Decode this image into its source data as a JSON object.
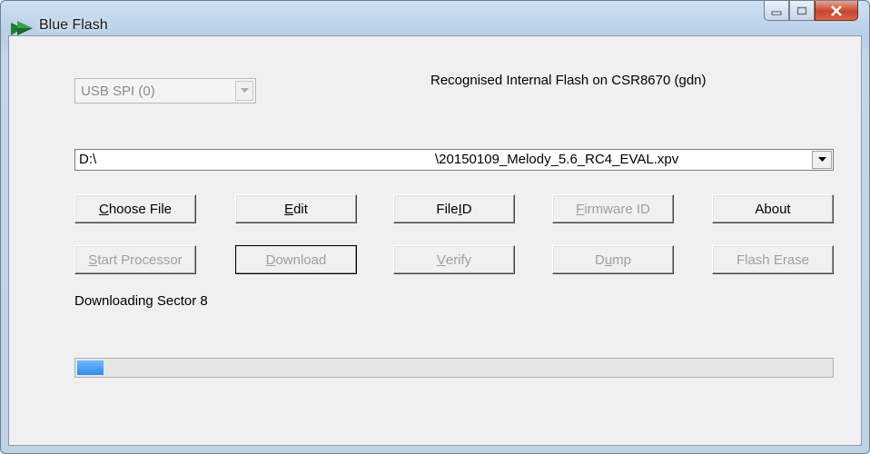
{
  "window": {
    "title": "Blue Flash",
    "icon": "blue-flash-app-icon"
  },
  "caption_buttons": {
    "minimize_icon": "minimize-icon",
    "maximize_icon": "maximize-icon",
    "close_icon": "close-icon"
  },
  "device": {
    "selected": "USB SPI (0)",
    "enabled": false
  },
  "recognised_text": "Recognised Internal Flash on CSR8670 (gdn)",
  "file_path": {
    "drive": "D:\\",
    "file": "\\20150109_Melody_5.6_RC4_EVAL.xpv"
  },
  "buttons_row1": [
    {
      "pre": "",
      "u": "C",
      "post": "hoose File",
      "enabled": true
    },
    {
      "pre": "",
      "u": "E",
      "post": "dit",
      "enabled": true
    },
    {
      "pre": "File ",
      "u": "I",
      "post": "D",
      "enabled": true
    },
    {
      "pre": "",
      "u": "F",
      "post": "irmware ID",
      "enabled": false
    },
    {
      "pre": "About",
      "u": "",
      "post": "",
      "enabled": true
    }
  ],
  "buttons_row2": [
    {
      "pre": "",
      "u": "S",
      "post": "tart Processor",
      "enabled": false
    },
    {
      "pre": "",
      "u": "D",
      "post": "ownload",
      "enabled": false
    },
    {
      "pre": "",
      "u": "V",
      "post": "erify",
      "enabled": false
    },
    {
      "pre": "D",
      "u": "u",
      "post": "mp",
      "enabled": false
    },
    {
      "pre": "Flash Erase",
      "u": "",
      "post": "",
      "enabled": false
    }
  ],
  "status": "Downloading Sector 8",
  "progress": {
    "fraction": 0.035,
    "color": "#2f8cf0"
  }
}
